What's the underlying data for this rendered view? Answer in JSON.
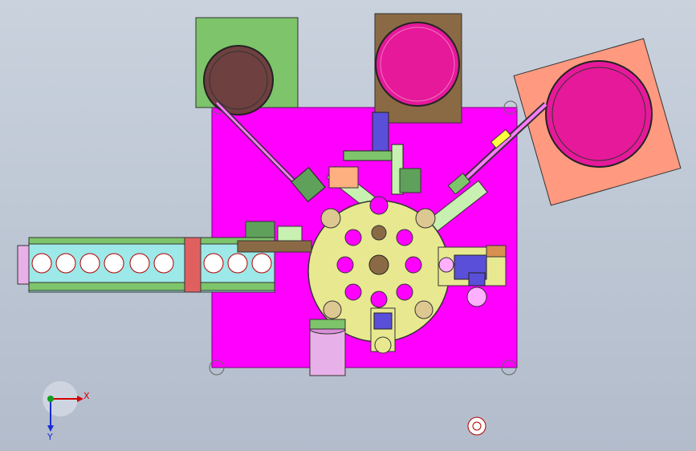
{
  "axis_triad": {
    "x_label": "X",
    "y_label": "Y"
  },
  "colors": {
    "background": "#bfc8d4",
    "base_plate": "#ff00ff",
    "turntable": "#e8e890",
    "feeder_green": "#7dc46a",
    "feeder_brown": "#8a6a45",
    "feeder_salmon": "#ff9a80",
    "bowl_pink": "#e6199a",
    "bowl_brown": "#6e4040",
    "conveyor": "#9de8e8",
    "motor": "#e8b0e8",
    "slider_blue": "#5a4fd8"
  },
  "parts": [
    {
      "name": "vibratory-feeder-left",
      "icon": "bowl"
    },
    {
      "name": "vibratory-feeder-middle",
      "icon": "bowl"
    },
    {
      "name": "vibratory-feeder-right",
      "icon": "bowl"
    },
    {
      "name": "rotary-indexing-table",
      "icon": "turntable"
    },
    {
      "name": "linear-conveyor",
      "icon": "conveyor"
    },
    {
      "name": "drive-motor",
      "icon": "cylinder"
    }
  ]
}
